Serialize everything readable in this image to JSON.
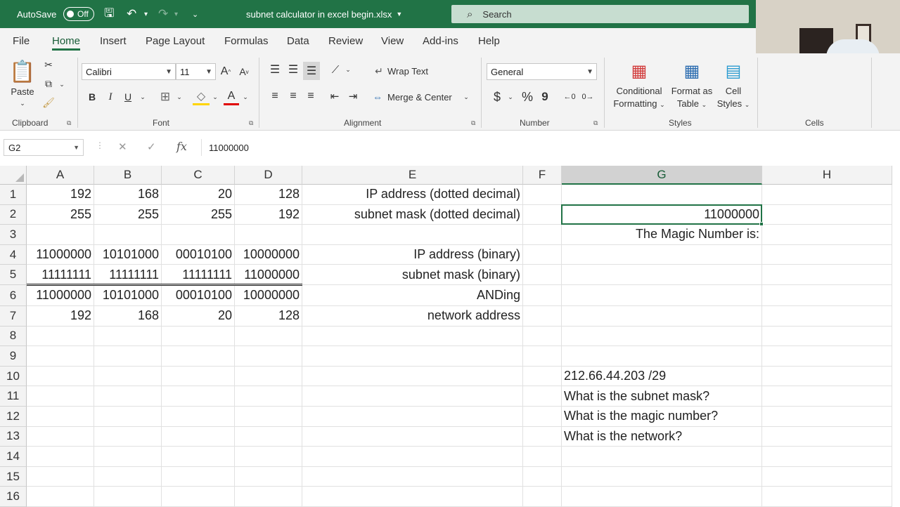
{
  "titlebar": {
    "autosave_label": "AutoSave",
    "autosave_state": "Off",
    "file_title": "subnet calculator in excel begin.xlsx",
    "search_placeholder": "Search",
    "accent_color": "#217346"
  },
  "tabs": [
    "File",
    "Home",
    "Insert",
    "Page Layout",
    "Formulas",
    "Data",
    "Review",
    "View",
    "Add-ins",
    "Help"
  ],
  "active_tab": "Home",
  "ribbon": {
    "clipboard": {
      "label": "Clipboard",
      "paste": "Paste"
    },
    "font": {
      "label": "Font",
      "family": "Calibri",
      "size": "11",
      "bold": "B",
      "italic": "I",
      "underline": "U"
    },
    "alignment": {
      "label": "Alignment",
      "wrap_text": "Wrap Text",
      "merge_center": "Merge & Center"
    },
    "number": {
      "label": "Number",
      "format": "General",
      "currency": "$",
      "percent": "%",
      "comma": "9"
    },
    "styles": {
      "label": "Styles",
      "conditional_formatting": [
        "Conditional",
        "Formatting"
      ],
      "format_as_table": [
        "Format as",
        "Table"
      ],
      "cell_styles": [
        "Cell",
        "Styles"
      ]
    },
    "cells": {
      "label": "Cells"
    }
  },
  "formula_bar": {
    "name_box": "G2",
    "fx": "fx",
    "value": "11000000"
  },
  "grid": {
    "columns": [
      "A",
      "B",
      "C",
      "D",
      "E",
      "F",
      "G",
      "H"
    ],
    "selected_column": "G",
    "rows": [
      "1",
      "2",
      "3",
      "4",
      "5",
      "6",
      "7",
      "8",
      "9",
      "10",
      "11",
      "12",
      "13",
      "14",
      "15",
      "16"
    ],
    "cells": {
      "A1": "192",
      "B1": "168",
      "C1": "20",
      "D1": "128",
      "E1": "IP address (dotted decimal)",
      "A2": "255",
      "B2": "255",
      "C2": "255",
      "D2": "192",
      "E2": "subnet mask (dotted decimal)",
      "G2": "11000000",
      "G3": "The Magic Number is:",
      "A4": "11000000",
      "B4": "10101000",
      "C4": "00010100",
      "D4": "10000000",
      "E4": "IP address (binary)",
      "A5": "11111111",
      "B5": "11111111",
      "C5": "11111111",
      "D5": "11000000",
      "E5": "subnet mask (binary)",
      "A6": "11000000",
      "B6": "10101000",
      "C6": "00010100",
      "D6": "10000000",
      "E6": "ANDing",
      "A7": "192",
      "B7": "168",
      "C7": "20",
      "D7": "128",
      "E7": "network address",
      "G10": "212.66.44.203 /29",
      "G11": "What is the subnet mask?",
      "G12": "What is the magic number?",
      "G13": "What is the network?"
    }
  }
}
